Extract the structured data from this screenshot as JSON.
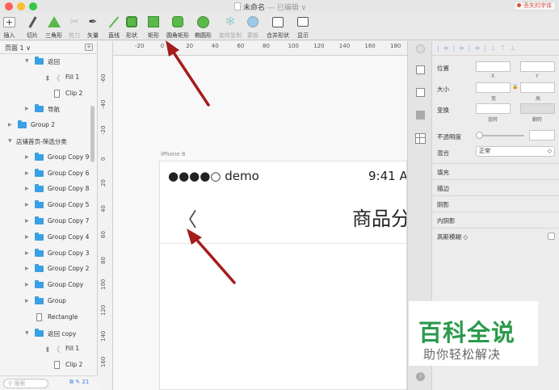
{
  "window": {
    "title": "未命名",
    "edited": "— 已编辑",
    "missing_fonts": "丢失的字体"
  },
  "toolbar": [
    {
      "label": "插入",
      "icon": "plus-icon",
      "enabled": true
    },
    {
      "label": "切片",
      "icon": "slice-knife-icon",
      "enabled": true
    },
    {
      "label": "三角形",
      "icon": "triangle-icon",
      "enabled": true
    },
    {
      "label": "剪刀",
      "icon": "scissors-icon",
      "enabled": false
    },
    {
      "label": "矢量",
      "icon": "pen-icon",
      "enabled": true
    },
    {
      "label": "直线",
      "icon": "line-icon",
      "enabled": true
    },
    {
      "label": "形状",
      "icon": "shapes-icon",
      "enabled": true
    },
    {
      "label": "矩形",
      "icon": "rectangle-icon",
      "enabled": true
    },
    {
      "label": "圆角矩形",
      "icon": "rounded-rectangle-icon",
      "enabled": true
    },
    {
      "label": "椭圆形",
      "icon": "oval-icon",
      "enabled": true
    },
    {
      "label": "旋转复制",
      "icon": "rotate-copy-icon",
      "enabled": false
    },
    {
      "label": "蒙板",
      "icon": "mask-icon",
      "enabled": false
    },
    {
      "label": "合并形状",
      "icon": "combine-shapes-icon",
      "enabled": true
    },
    {
      "label": "显示",
      "icon": "display-icon",
      "enabled": true
    }
  ],
  "left_panel": {
    "page_selector": "页面 1 ∨",
    "layers": [
      {
        "indent": 1,
        "arrow": "▼",
        "kind": "folder",
        "label": "返回"
      },
      {
        "indent": 3,
        "arrow": "",
        "kind": "chevron",
        "label": "Fill 1"
      },
      {
        "indent": 3,
        "arrow": "",
        "kind": "rect",
        "label": "Clip 2"
      },
      {
        "indent": 1,
        "arrow": "▶",
        "kind": "folder",
        "label": "导航"
      },
      {
        "indent": 0,
        "arrow": "▶",
        "kind": "folder",
        "label": "Group 2"
      },
      {
        "indent": 0,
        "arrow": "▼",
        "kind": "artboard",
        "label": "店铺首页-筛选分类"
      },
      {
        "indent": 1,
        "arrow": "▶",
        "kind": "folder",
        "label": "Group Copy 9"
      },
      {
        "indent": 1,
        "arrow": "▶",
        "kind": "folder",
        "label": "Group Copy 6"
      },
      {
        "indent": 1,
        "arrow": "▶",
        "kind": "folder",
        "label": "Group Copy 8"
      },
      {
        "indent": 1,
        "arrow": "▶",
        "kind": "folder",
        "label": "Group Copy 5"
      },
      {
        "indent": 1,
        "arrow": "▶",
        "kind": "folder",
        "label": "Group Copy 7"
      },
      {
        "indent": 1,
        "arrow": "▶",
        "kind": "folder",
        "label": "Group Copy 4"
      },
      {
        "indent": 1,
        "arrow": "▶",
        "kind": "folder",
        "label": "Group Copy 3"
      },
      {
        "indent": 1,
        "arrow": "▶",
        "kind": "folder",
        "label": "Group Copy 2"
      },
      {
        "indent": 1,
        "arrow": "▶",
        "kind": "folder",
        "label": "Group Copy"
      },
      {
        "indent": 1,
        "arrow": "▶",
        "kind": "folder",
        "label": "Group"
      },
      {
        "indent": 1,
        "arrow": "",
        "kind": "rect",
        "label": "Rectangle"
      },
      {
        "indent": 1,
        "arrow": "▼",
        "kind": "folder",
        "label": "返回 copy"
      },
      {
        "indent": 3,
        "arrow": "",
        "kind": "chevron",
        "label": "Fill 1"
      },
      {
        "indent": 3,
        "arrow": "",
        "kind": "rect",
        "label": "Clip 2"
      }
    ],
    "search_placeholder": "搜索",
    "footer_count": "21"
  },
  "rulers": {
    "horizontal": [
      "-20",
      "0",
      "20",
      "40",
      "60",
      "80",
      "100",
      "120",
      "140",
      "160",
      "180"
    ],
    "vertical": [
      "-60",
      "-40",
      "-20",
      "0",
      "20",
      "40",
      "60",
      "80",
      "100",
      "120",
      "140",
      "160"
    ]
  },
  "canvas": {
    "artboard_label": "iPhone 8",
    "carrier": "●●●●○ demo",
    "time": "9:41 A",
    "back_glyph": "〈",
    "nav_title": "商品分"
  },
  "inspector": {
    "position_label": "位置",
    "x_label": "X",
    "y_label": "Y",
    "size_label": "大小",
    "width_label": "宽",
    "height_label": "高",
    "transform_label": "变换",
    "rotate_label": "旋转",
    "flip_label": "翻转",
    "opacity_label": "不透明度",
    "blend_label": "混合",
    "blend_value": "正常",
    "fill": "填充",
    "border": "描边",
    "shadow": "阴影",
    "inner_shadow": "内阴影",
    "gaussian_blur": "高斯模糊 ◇"
  },
  "watermark": {
    "title": "百科全说",
    "subtitle": "助你轻松解决"
  },
  "colors": {
    "accent_blue": "#3aa0e3",
    "arrow_red": "#a51c1c",
    "watermark_green": "#2b9a4b"
  }
}
